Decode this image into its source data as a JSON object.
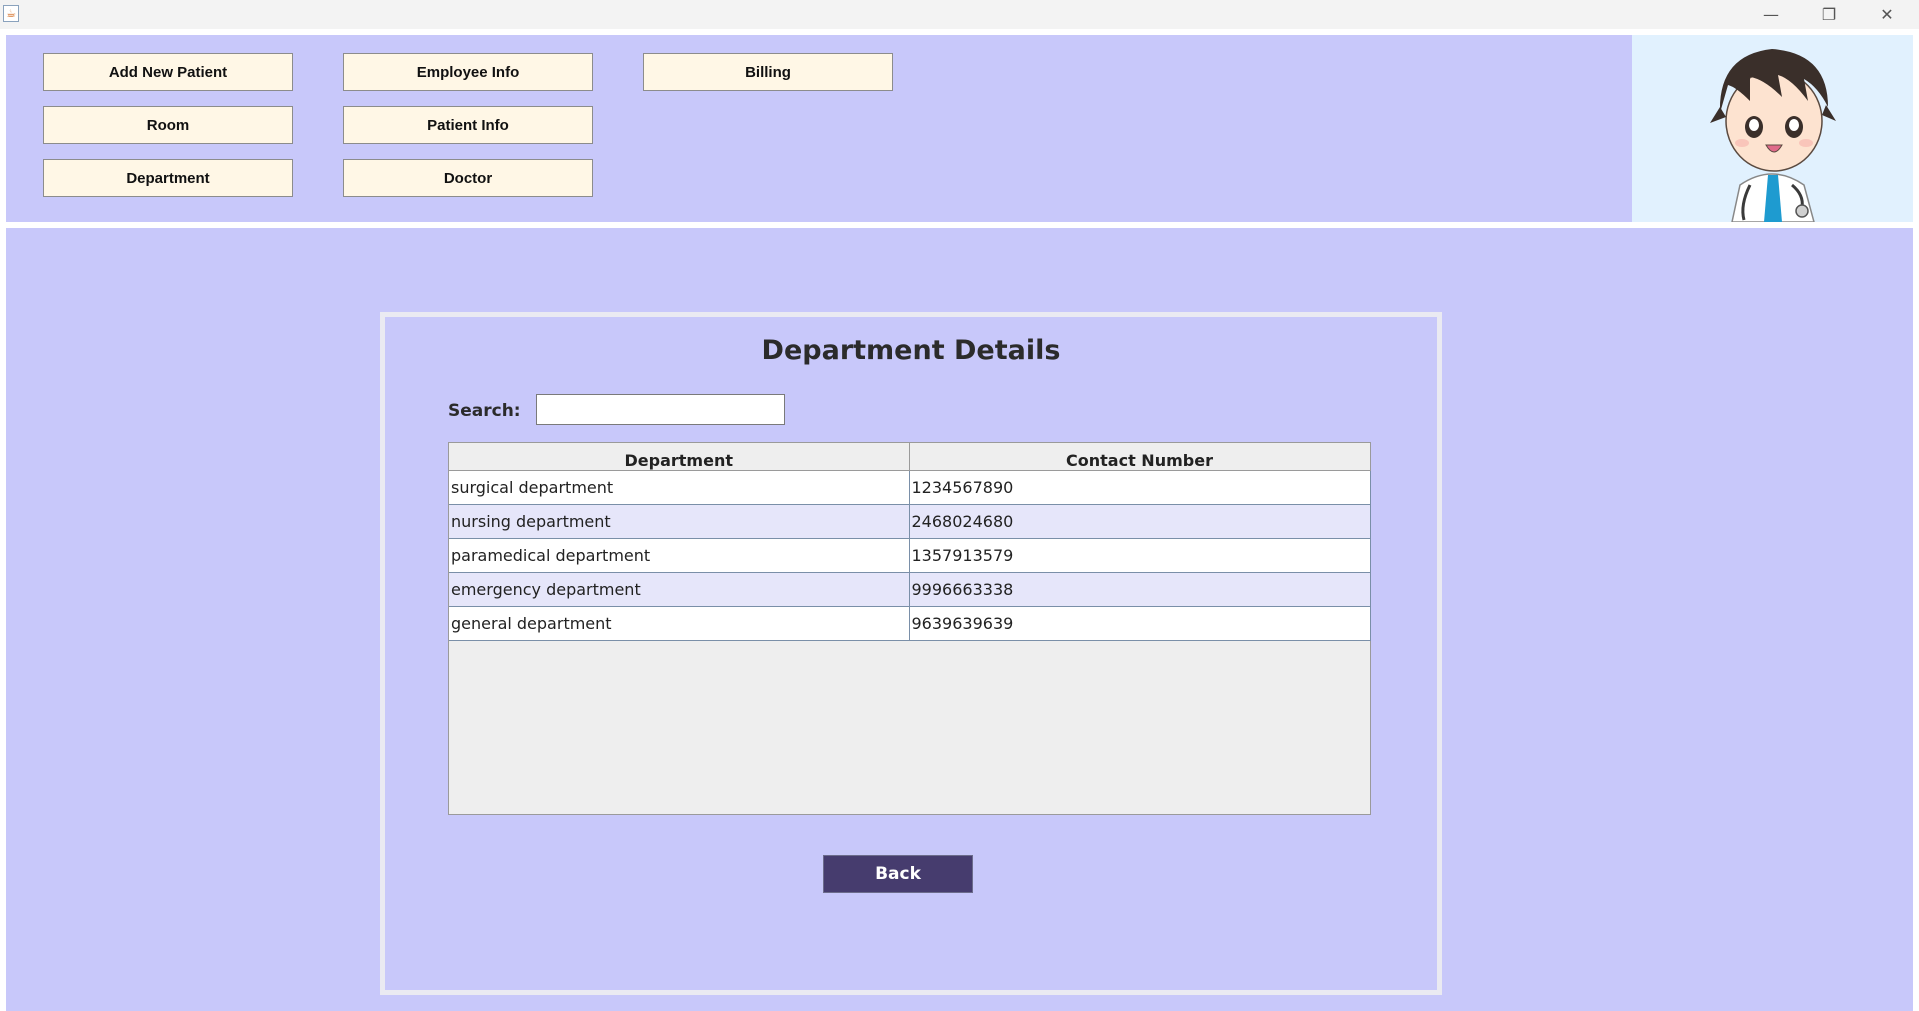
{
  "window": {
    "minimize_icon": "minimize-icon",
    "maximize_icon": "restore-icon",
    "close_icon": "close-icon"
  },
  "nav": {
    "add_new_patient": "Add New Patient",
    "employee_info": "Employee Info",
    "billing": "Billing",
    "room": "Room",
    "patient_info": "Patient Info",
    "department": "Department",
    "doctor": "Doctor"
  },
  "details": {
    "title": "Department Details",
    "search_label": "Search:",
    "search_value": "",
    "columns": [
      "Department",
      "Contact Number"
    ],
    "rows": [
      [
        "surgical department",
        "1234567890"
      ],
      [
        "nursing department",
        "2468024680"
      ],
      [
        "paramedical department",
        "1357913579"
      ],
      [
        "emergency department",
        "9996663338"
      ],
      [
        "general department",
        "9639639639"
      ]
    ],
    "back_label": "Back"
  },
  "colors": {
    "panel_bg": "#c8c8fa",
    "nav_button_bg": "#fff7e6",
    "back_button_bg": "#463c6e",
    "row_alt_bg": "#e6e6fa"
  }
}
